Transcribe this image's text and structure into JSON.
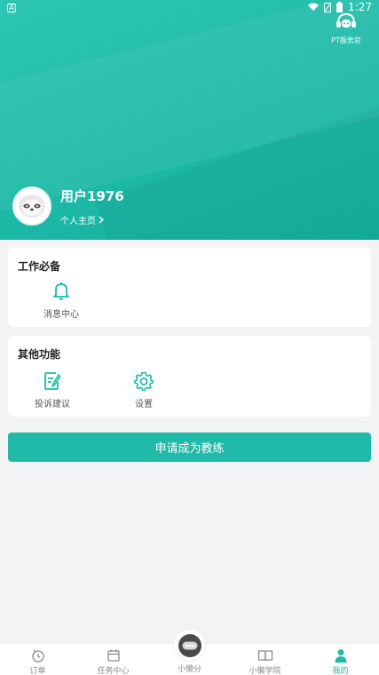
{
  "status_bar": {
    "time": "1:27"
  },
  "header": {
    "customer_service_label": "PT服务官",
    "username": "用户1976",
    "homepage_link": "个人主页"
  },
  "work_section": {
    "title": "工作必备",
    "items": [
      {
        "label": "消息中心",
        "icon": "bell-icon"
      }
    ]
  },
  "other_section": {
    "title": "其他功能",
    "items": [
      {
        "label": "投诉建议",
        "icon": "feedback-icon"
      },
      {
        "label": "设置",
        "icon": "gear-icon"
      }
    ]
  },
  "apply_button": "申请成为教练",
  "tabbar": {
    "items": [
      {
        "label": "订单",
        "icon": "clock-icon"
      },
      {
        "label": "任务中心",
        "icon": "calendar-icon"
      },
      {
        "label": "小懒分",
        "icon": "robot-icon"
      },
      {
        "label": "小懒学院",
        "icon": "book-icon"
      },
      {
        "label": "我的",
        "icon": "person-icon"
      }
    ],
    "active": "我的"
  },
  "colors": {
    "accent": "#1fbaa8",
    "background": "#f2f3f5"
  }
}
